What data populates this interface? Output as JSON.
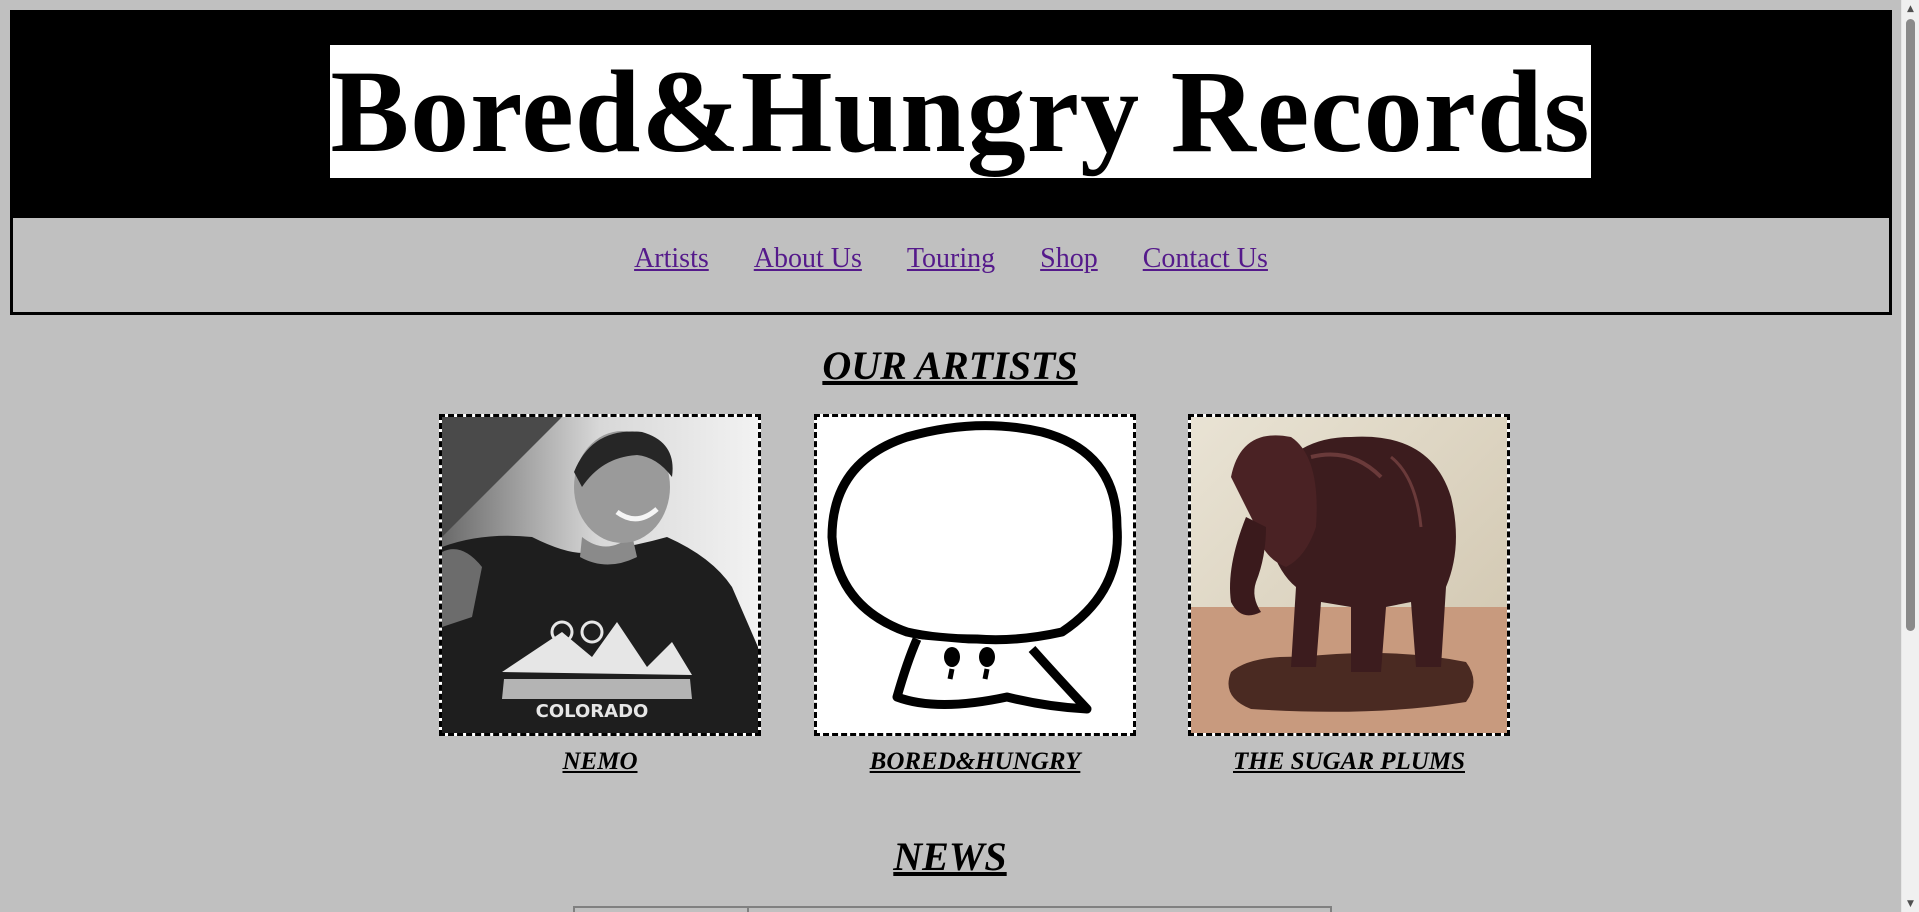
{
  "header": {
    "title": "Bored&Hungry Records"
  },
  "nav": {
    "items": [
      {
        "label": "Artists"
      },
      {
        "label": "About Us"
      },
      {
        "label": "Touring"
      },
      {
        "label": "Shop"
      },
      {
        "label": "Contact Us"
      }
    ]
  },
  "artists_section": {
    "heading": "OUR ARTISTS",
    "artists": [
      {
        "name": "NEMO",
        "image": "photo-person-icon",
        "shirt_text": "COLORADO"
      },
      {
        "name": "BORED&HUNGRY",
        "image": "mushroom-drawing-icon"
      },
      {
        "name": "THE SUGAR PLUMS",
        "image": "elephant-statue-icon"
      }
    ]
  },
  "news_section": {
    "heading": "NEWS"
  },
  "colors": {
    "page_background": "#c0c0c0",
    "banner_background": "#000000",
    "title_background": "#ffffff",
    "link_color": "#551a8b"
  }
}
